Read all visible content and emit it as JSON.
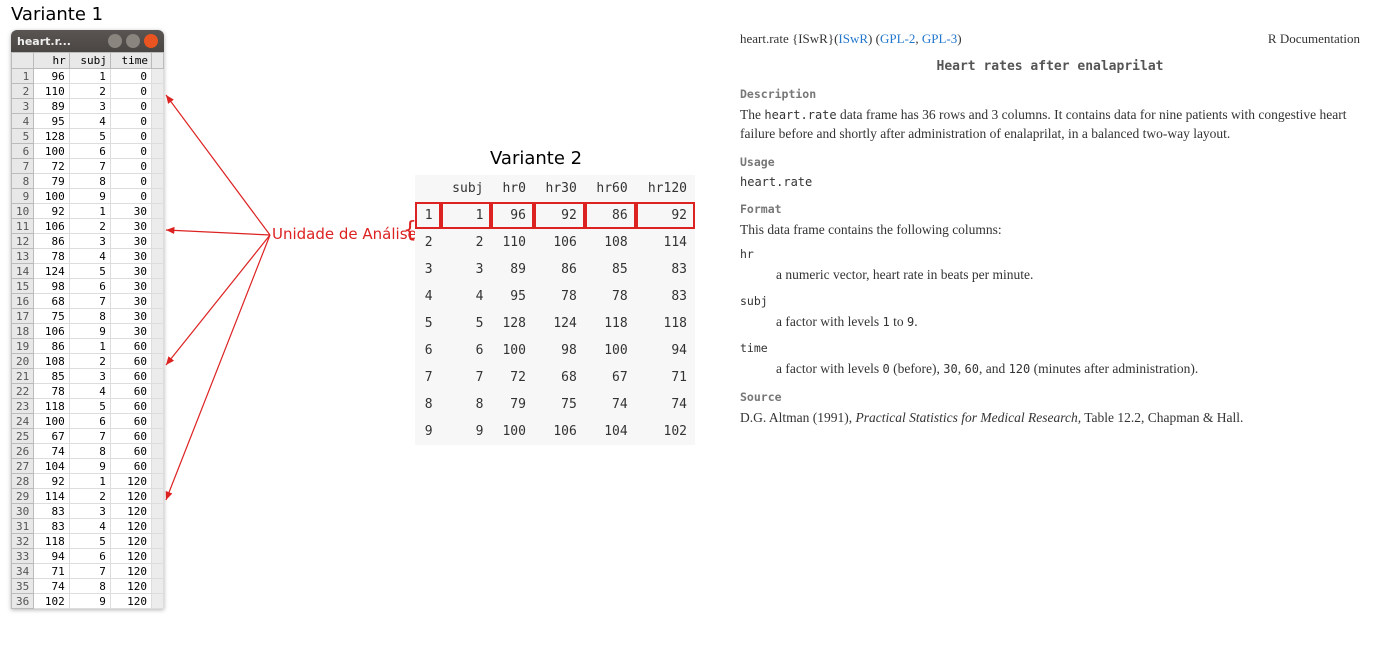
{
  "variant1_label": "Variante 1",
  "variant2_label": "Variante 2",
  "annotation_label": "Unidade de Análise",
  "window_title": "heart.r...",
  "table1": {
    "headers": [
      "",
      "hr",
      "subj",
      "time"
    ],
    "rows": [
      [
        "1",
        "96",
        "1",
        "0"
      ],
      [
        "2",
        "110",
        "2",
        "0"
      ],
      [
        "3",
        "89",
        "3",
        "0"
      ],
      [
        "4",
        "95",
        "4",
        "0"
      ],
      [
        "5",
        "128",
        "5",
        "0"
      ],
      [
        "6",
        "100",
        "6",
        "0"
      ],
      [
        "7",
        "72",
        "7",
        "0"
      ],
      [
        "8",
        "79",
        "8",
        "0"
      ],
      [
        "9",
        "100",
        "9",
        "0"
      ],
      [
        "10",
        "92",
        "1",
        "30"
      ],
      [
        "11",
        "106",
        "2",
        "30"
      ],
      [
        "12",
        "86",
        "3",
        "30"
      ],
      [
        "13",
        "78",
        "4",
        "30"
      ],
      [
        "14",
        "124",
        "5",
        "30"
      ],
      [
        "15",
        "98",
        "6",
        "30"
      ],
      [
        "16",
        "68",
        "7",
        "30"
      ],
      [
        "17",
        "75",
        "8",
        "30"
      ],
      [
        "18",
        "106",
        "9",
        "30"
      ],
      [
        "19",
        "86",
        "1",
        "60"
      ],
      [
        "20",
        "108",
        "2",
        "60"
      ],
      [
        "21",
        "85",
        "3",
        "60"
      ],
      [
        "22",
        "78",
        "4",
        "60"
      ],
      [
        "23",
        "118",
        "5",
        "60"
      ],
      [
        "24",
        "100",
        "6",
        "60"
      ],
      [
        "25",
        "67",
        "7",
        "60"
      ],
      [
        "26",
        "74",
        "8",
        "60"
      ],
      [
        "27",
        "104",
        "9",
        "60"
      ],
      [
        "28",
        "92",
        "1",
        "120"
      ],
      [
        "29",
        "114",
        "2",
        "120"
      ],
      [
        "30",
        "83",
        "3",
        "120"
      ],
      [
        "31",
        "83",
        "4",
        "120"
      ],
      [
        "32",
        "118",
        "5",
        "120"
      ],
      [
        "33",
        "94",
        "6",
        "120"
      ],
      [
        "34",
        "71",
        "7",
        "120"
      ],
      [
        "35",
        "74",
        "8",
        "120"
      ],
      [
        "36",
        "102",
        "9",
        "120"
      ]
    ]
  },
  "table2": {
    "headers": [
      "",
      "subj",
      "hr0",
      "hr30",
      "hr60",
      "hr120"
    ],
    "rows": [
      [
        "1",
        "1",
        "96",
        "92",
        "86",
        "92"
      ],
      [
        "2",
        "2",
        "110",
        "106",
        "108",
        "114"
      ],
      [
        "3",
        "3",
        "89",
        "86",
        "85",
        "83"
      ],
      [
        "4",
        "4",
        "95",
        "78",
        "78",
        "83"
      ],
      [
        "5",
        "5",
        "128",
        "124",
        "118",
        "118"
      ],
      [
        "6",
        "6",
        "100",
        "98",
        "100",
        "94"
      ],
      [
        "7",
        "7",
        "72",
        "68",
        "67",
        "71"
      ],
      [
        "8",
        "8",
        "79",
        "75",
        "74",
        "74"
      ],
      [
        "9",
        "9",
        "100",
        "106",
        "104",
        "102"
      ]
    ]
  },
  "doc": {
    "pkg_name": "heart.rate {ISwR}",
    "link1": "ISwR",
    "link2": "GPL-2",
    "link3": "GPL-3",
    "rdoc": "R Documentation",
    "title": "Heart rates after enalaprilat",
    "desc_h": "Description",
    "desc_p1a": "The ",
    "desc_code": "heart.rate",
    "desc_p1b": " data frame has 36 rows and 3 columns. It contains data for nine patients with congestive heart failure before and shortly after administration of enalaprilat, in a balanced two-way layout.",
    "usage_h": "Usage",
    "usage_code": "heart.rate",
    "format_h": "Format",
    "format_p": "This data frame contains the following columns:",
    "col1_name": "hr",
    "col1_desc": "a numeric vector, heart rate in beats per minute.",
    "col2_name": "subj",
    "col2_desc_a": "a factor with levels ",
    "col2_code1": "1",
    "col2_mid": " to ",
    "col2_code2": "9",
    "col2_end": ".",
    "col3_name": "time",
    "col3_desc_a": "a factor with levels ",
    "col3_code1": "0",
    "col3_mid1": " (before), ",
    "col3_code2": "30",
    "col3_mid2": ", ",
    "col3_code3": "60",
    "col3_mid3": ", and ",
    "col3_code4": "120",
    "col3_end": " (minutes after administration).",
    "source_h": "Source",
    "source_a": "D.G. Altman (1991), ",
    "source_i": "Practical Statistics for Medical Research,",
    "source_b": " Table 12.2, Chapman & Hall."
  }
}
